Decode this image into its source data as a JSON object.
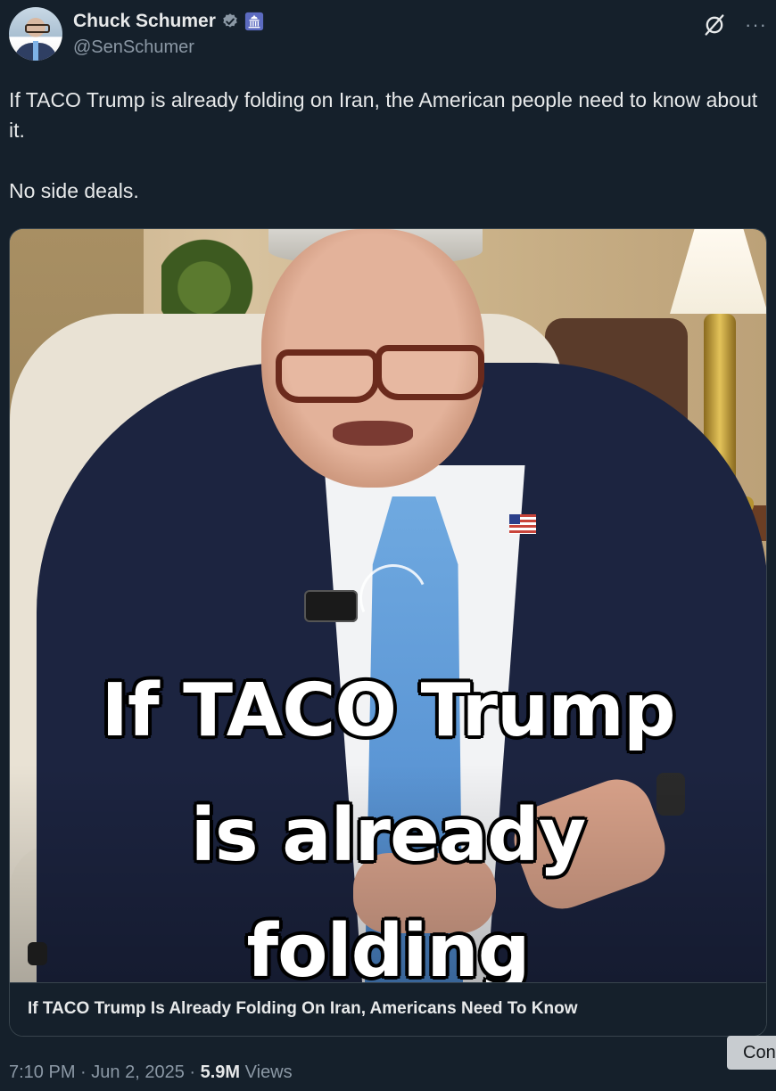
{
  "author": {
    "name": "Chuck Schumer",
    "handle": "@SenSchumer"
  },
  "icons": {
    "verified": "verified-check-icon",
    "government_badge": "government-capitol-icon",
    "grok": "grok-icon",
    "more": "more-options-icon"
  },
  "tweet": {
    "text": "If TACO Trump is already folding on Iran, the American people need to know about it.\n\nNo side deals."
  },
  "media": {
    "caption_line_1": "If TACO Trump",
    "caption_line_2": "is already",
    "caption_line_3": "folding",
    "card_title": "If TACO Trump Is Already Folding On Iran, Americans Need To Know"
  },
  "meta": {
    "time": "7:10 PM",
    "separator": "·",
    "date": "Jun 2, 2025",
    "views_count": "5.9M",
    "views_label": "Views"
  },
  "overlay": {
    "conversation_label": "Con"
  },
  "colors": {
    "background": "#15202b",
    "text_primary": "#e7e9ea",
    "text_secondary": "#8b98a5",
    "verified_badge": "#8b98a5",
    "gov_badge": "#5c6bc0"
  }
}
